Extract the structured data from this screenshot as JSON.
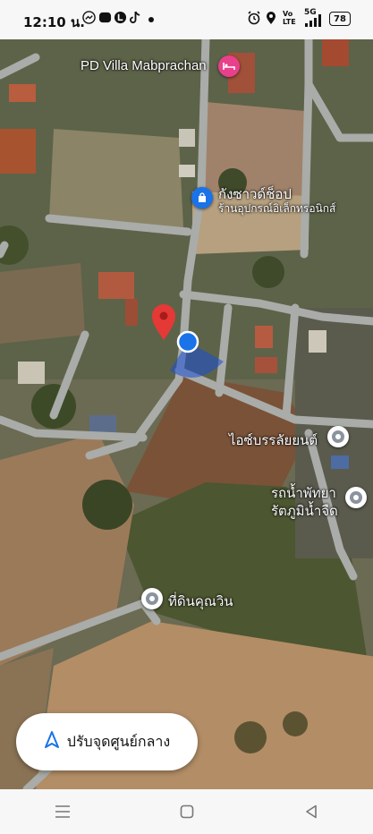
{
  "status_bar": {
    "time": "12:10 น.",
    "network": "5G",
    "volte": "Vo LTE",
    "battery": "78"
  },
  "map": {
    "places": [
      {
        "name": "PD Villa Mabprachan",
        "icon": "hotel-icon"
      },
      {
        "name": "กังซาวด์ช็อป",
        "subtitle": "ร้านอุปกรณ์อิเล็กทรอนิกส์",
        "icon": "shopping-bag-icon"
      },
      {
        "name": "ไอซ์บรรลัยยนต์",
        "icon": "place-pin-icon"
      },
      {
        "name": "รถน้ำพัทยา",
        "name2": "รัตภูมิน้ำจืด",
        "icon": "place-pin-icon"
      },
      {
        "name": "ที่ดินคุณวิน",
        "icon": "place-pin-icon"
      }
    ],
    "colors": {
      "selected_pin": "#e53935",
      "location_dot": "#1a73e8",
      "hotel_pin": "#e8408a"
    }
  },
  "recenter_button": {
    "label": "ปรับจุดศูนย์กลาง",
    "icon": "navigation-arrow-icon"
  },
  "nav_bar": {
    "icons": [
      "menu-icon",
      "home-icon",
      "back-icon"
    ]
  }
}
